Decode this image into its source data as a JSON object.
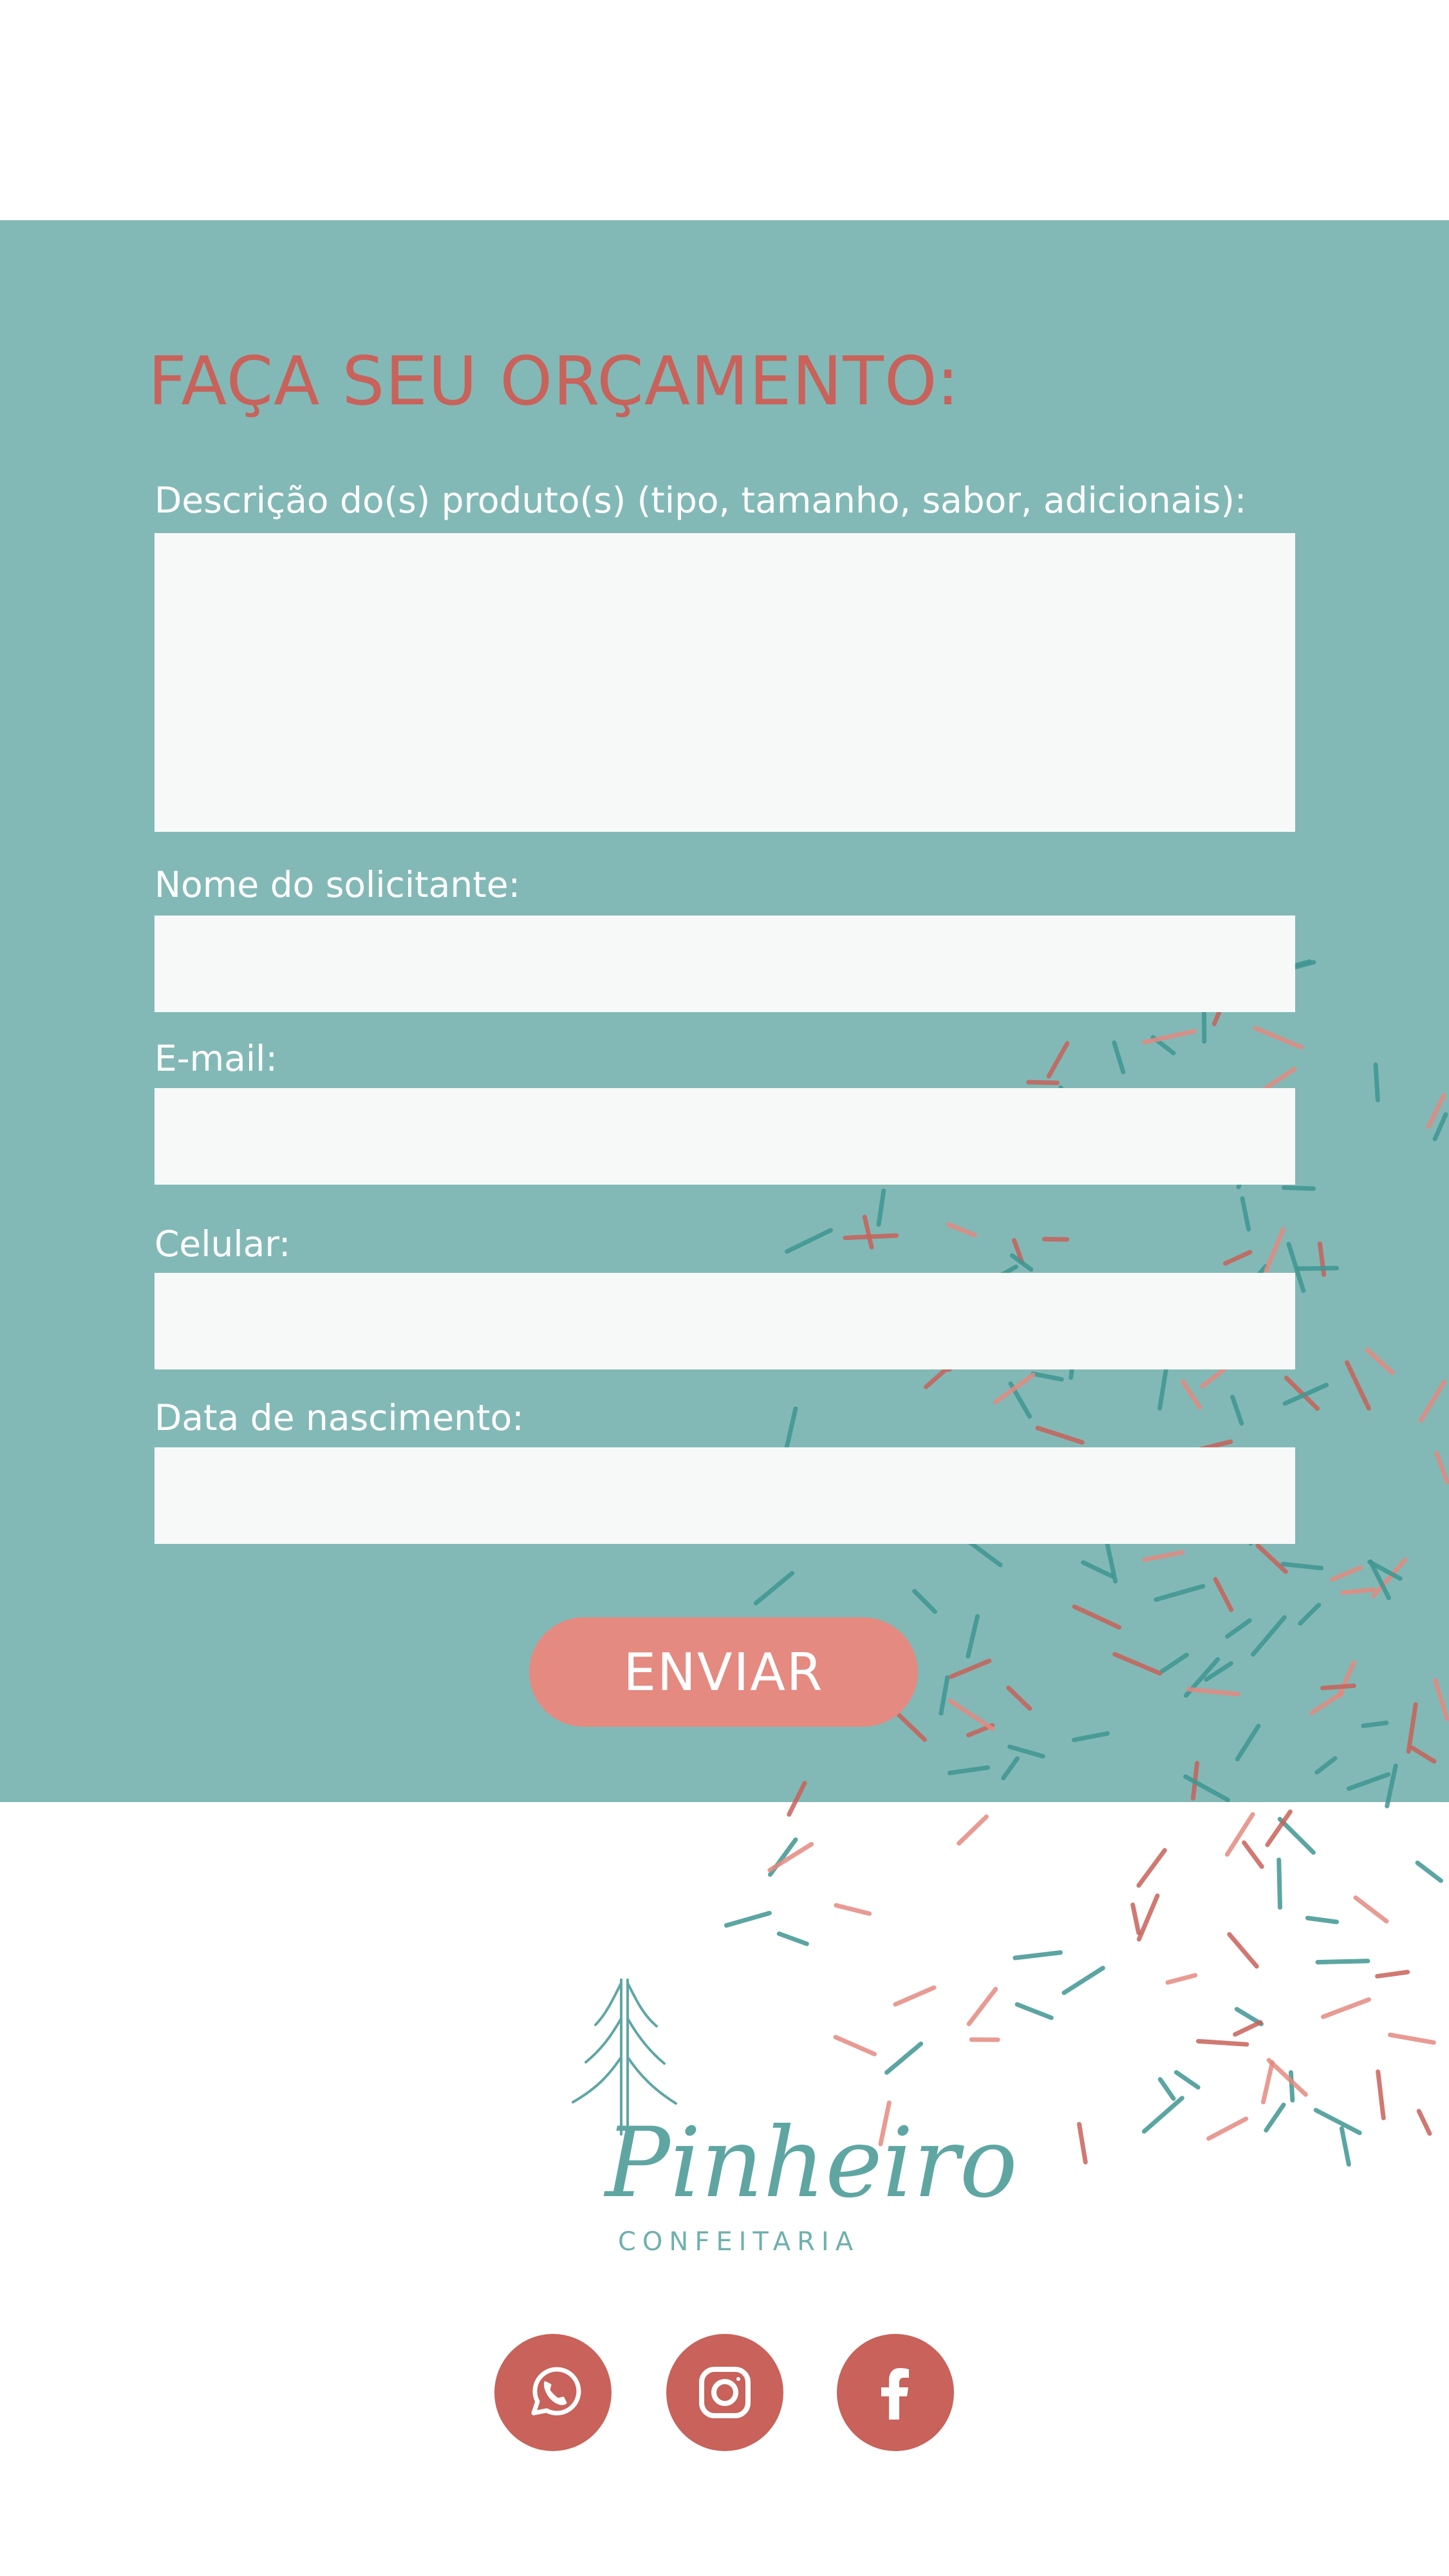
{
  "form": {
    "title": "FAÇA SEU ORÇAMENTO:",
    "fields": {
      "description": {
        "label": "Descrição do(s) produto(s) (tipo, tamanho, sabor, adicionais):",
        "value": ""
      },
      "name": {
        "label": "Nome do solicitante:",
        "value": ""
      },
      "email": {
        "label": "E-mail:",
        "value": ""
      },
      "phone": {
        "label": "Celular:",
        "value": ""
      },
      "birthdate": {
        "label": "Data de nascimento:",
        "value": ""
      }
    },
    "submit_label": "ENVIAR"
  },
  "brand": {
    "name": "Pinheiro",
    "subtitle": "CONFEITARIA",
    "logo_icon": "pine-tree-icon"
  },
  "social": [
    {
      "name": "whatsapp",
      "icon": "whatsapp-icon"
    },
    {
      "name": "instagram",
      "icon": "instagram-icon"
    },
    {
      "name": "facebook",
      "icon": "facebook-icon"
    }
  ],
  "colors": {
    "panel_background": "#82b9b6",
    "title": "#c8625a",
    "input_background": "#f7f9f8",
    "button": "#e48a81",
    "social_background": "#c8625a",
    "confetti_teal": "#3f9692",
    "confetti_red": "#c8625a",
    "confetti_pink": "#e48a81"
  }
}
